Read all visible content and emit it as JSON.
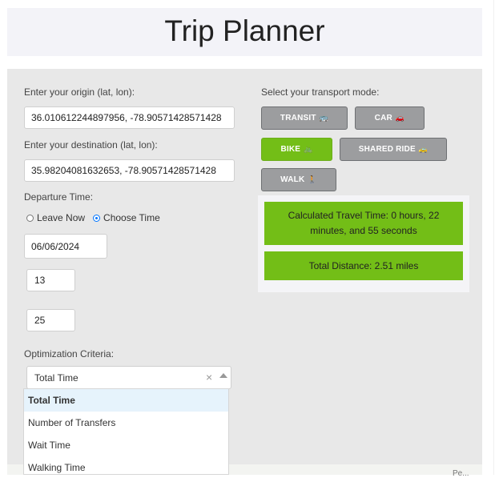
{
  "app": {
    "title": "Trip Planner"
  },
  "origin": {
    "label": "Enter your origin (lat, lon):",
    "value": "36.010612244897956, -78.90571428571428"
  },
  "destination": {
    "label": "Enter your destination (lat, lon):",
    "value": "35.98204081632653, -78.90571428571428"
  },
  "departure": {
    "label": "Departure Time:",
    "options": [
      "Leave Now",
      "Choose Time"
    ],
    "selected_option": "Choose Time",
    "date": "06/06/2024",
    "hour": "13",
    "minute": "25"
  },
  "optimization": {
    "label": "Optimization Criteria:",
    "selected": "Total Time",
    "clear_symbol": "×",
    "options": [
      "Total Time",
      "Number of Transfers",
      "Wait Time",
      "Walking Time"
    ]
  },
  "transport": {
    "label": "Select your transport mode:",
    "modes": [
      {
        "label": "TRANSIT",
        "icon": "bus-icon",
        "active": false
      },
      {
        "label": "CAR",
        "icon": "car-icon",
        "active": false
      },
      {
        "label": "BIKE",
        "icon": "bike-icon",
        "active": true
      },
      {
        "label": "SHARED RIDE",
        "icon": "shared-car-icon",
        "active": false
      },
      {
        "label": "WALK",
        "icon": "walk-icon",
        "active": false
      }
    ]
  },
  "results": {
    "travel_time": "Calculated Travel Time: 0 hours, 22 minutes, and 55 seconds",
    "distance": "Total Distance: 2.51 miles"
  },
  "map": {
    "partial_label": "Pe..."
  },
  "colors": {
    "active": "#73be17",
    "inactive": "#9c9d9f",
    "panel": "#e8e8e8",
    "header": "#f3f3f8"
  }
}
